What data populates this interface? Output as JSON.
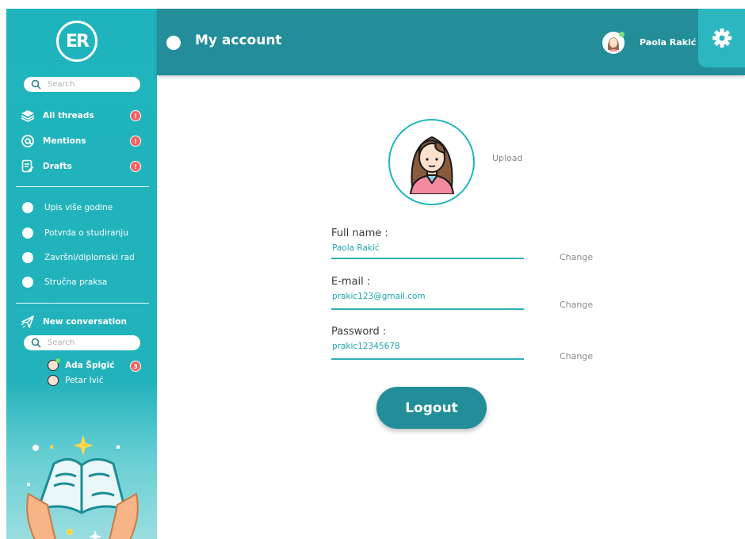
{
  "sidebar": {
    "logo_text": "ER",
    "search_placeholder": "Search",
    "nav": [
      {
        "label": "All threads",
        "icon": "layers-icon",
        "badge": "!"
      },
      {
        "label": "Mentions",
        "icon": "at-icon",
        "badge": "!"
      },
      {
        "label": "Drafts",
        "icon": "draft-icon",
        "badge": "!"
      }
    ],
    "threads": [
      "Upis više godine",
      "Potvrda o studiranju",
      "Završni/diplomski rad",
      "Stručna praksa"
    ],
    "new_conversation_label": "New conversation",
    "contacts_search_placeholder": "Search",
    "contacts": [
      {
        "name": "Ada Špigić",
        "online": true,
        "badge": "3"
      },
      {
        "name": "Petar Ivić",
        "online": false,
        "badge": ""
      }
    ]
  },
  "header": {
    "title": "My account",
    "user_name": "Paola Rakić"
  },
  "account": {
    "upload_label": "Upload",
    "full_name_label": "Full name :",
    "full_name_value": "Paola Rakić",
    "email_label": "E-mail :",
    "email_value": "prakic123@gmail.com",
    "password_label": "Password :",
    "password_value": "prakic12345678",
    "change_label": "Change",
    "logout_label": "Logout"
  },
  "colors": {
    "sidebar": "#1fb4bd",
    "topbar": "#238e99",
    "badge": "#f06161",
    "accent_text": "#22a7b0"
  }
}
